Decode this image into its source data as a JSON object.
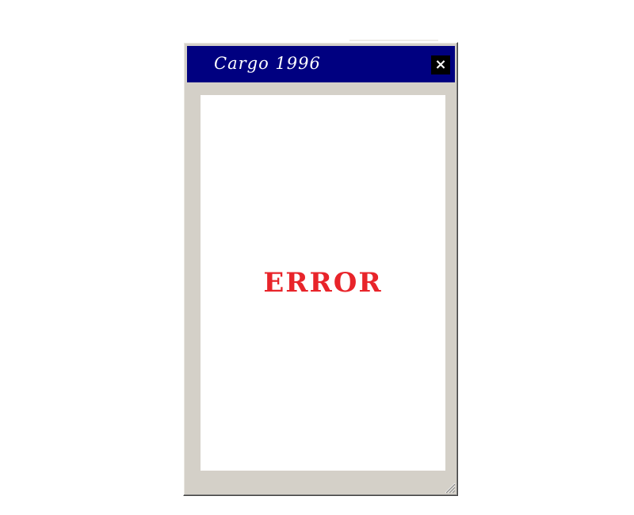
{
  "window": {
    "title": "Cargo 1996",
    "close_label": "×",
    "message": "ERROR"
  },
  "colors": {
    "titlebar": "#000080",
    "frame": "#d4d0c8",
    "error": "#e8242a"
  },
  "icons": {
    "close": "close-icon",
    "resize": "resize-grip-icon"
  }
}
